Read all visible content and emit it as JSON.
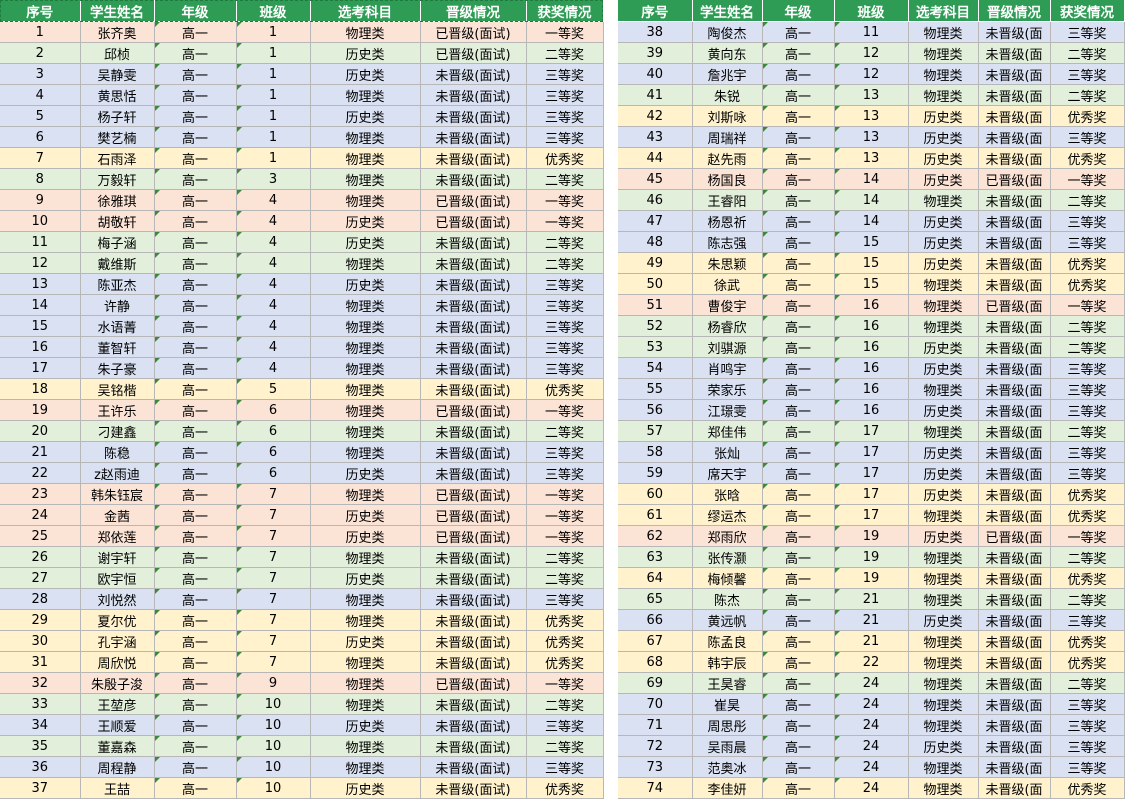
{
  "headers": [
    "序号",
    "学生姓名",
    "年级",
    "班级",
    "选考科目",
    "晋级情况",
    "获奖情况"
  ],
  "colors": {
    "header_bg": "#2e9c55",
    "一等奖": "#fbe3d6",
    "二等奖": "#e2efda",
    "三等奖": "#d9e1f2",
    "优秀奖": "#fff2cc"
  },
  "left_rows": [
    [
      "1",
      "张齐奥",
      "高一",
      "1",
      "物理类",
      "已晋级(面试)",
      "一等奖"
    ],
    [
      "2",
      "邱桢",
      "高一",
      "1",
      "历史类",
      "已晋级(面试)",
      "二等奖"
    ],
    [
      "3",
      "吴静雯",
      "高一",
      "1",
      "历史类",
      "未晋级(面试)",
      "三等奖"
    ],
    [
      "4",
      "黄思恬",
      "高一",
      "1",
      "物理类",
      "未晋级(面试)",
      "三等奖"
    ],
    [
      "5",
      "杨子轩",
      "高一",
      "1",
      "历史类",
      "未晋级(面试)",
      "三等奖"
    ],
    [
      "6",
      "樊艺楠",
      "高一",
      "1",
      "物理类",
      "未晋级(面试)",
      "三等奖"
    ],
    [
      "7",
      "石雨泽",
      "高一",
      "1",
      "物理类",
      "未晋级(面试)",
      "优秀奖"
    ],
    [
      "8",
      "万毅轩",
      "高一",
      "3",
      "物理类",
      "未晋级(面试)",
      "二等奖"
    ],
    [
      "9",
      "徐雅琪",
      "高一",
      "4",
      "物理类",
      "已晋级(面试)",
      "一等奖"
    ],
    [
      "10",
      "胡敬轩",
      "高一",
      "4",
      "历史类",
      "已晋级(面试)",
      "一等奖"
    ],
    [
      "11",
      "梅子涵",
      "高一",
      "4",
      "历史类",
      "未晋级(面试)",
      "二等奖"
    ],
    [
      "12",
      "戴维斯",
      "高一",
      "4",
      "物理类",
      "未晋级(面试)",
      "二等奖"
    ],
    [
      "13",
      "陈亚杰",
      "高一",
      "4",
      "历史类",
      "未晋级(面试)",
      "三等奖"
    ],
    [
      "14",
      "许静",
      "高一",
      "4",
      "物理类",
      "未晋级(面试)",
      "三等奖"
    ],
    [
      "15",
      "水语菁",
      "高一",
      "4",
      "物理类",
      "未晋级(面试)",
      "三等奖"
    ],
    [
      "16",
      "董智轩",
      "高一",
      "4",
      "物理类",
      "未晋级(面试)",
      "三等奖"
    ],
    [
      "17",
      "朱子豪",
      "高一",
      "4",
      "物理类",
      "未晋级(面试)",
      "三等奖"
    ],
    [
      "18",
      "吴铭楷",
      "高一",
      "5",
      "物理类",
      "未晋级(面试)",
      "优秀奖"
    ],
    [
      "19",
      "王许乐",
      "高一",
      "6",
      "物理类",
      "已晋级(面试)",
      "一等奖"
    ],
    [
      "20",
      "刁建鑫",
      "高一",
      "6",
      "物理类",
      "未晋级(面试)",
      "二等奖"
    ],
    [
      "21",
      "陈稳",
      "高一",
      "6",
      "物理类",
      "未晋级(面试)",
      "三等奖"
    ],
    [
      "22",
      "z赵雨迪",
      "高一",
      "6",
      "历史类",
      "未晋级(面试)",
      "三等奖"
    ],
    [
      "23",
      "韩朱钰宸",
      "高一",
      "7",
      "物理类",
      "已晋级(面试)",
      "一等奖"
    ],
    [
      "24",
      "金茜",
      "高一",
      "7",
      "历史类",
      "已晋级(面试)",
      "一等奖"
    ],
    [
      "25",
      "郑依莲",
      "高一",
      "7",
      "历史类",
      "已晋级(面试)",
      "一等奖"
    ],
    [
      "26",
      "谢宇轩",
      "高一",
      "7",
      "物理类",
      "未晋级(面试)",
      "二等奖"
    ],
    [
      "27",
      "欧宇恒",
      "高一",
      "7",
      "历史类",
      "未晋级(面试)",
      "二等奖"
    ],
    [
      "28",
      "刘悦然",
      "高一",
      "7",
      "物理类",
      "未晋级(面试)",
      "三等奖"
    ],
    [
      "29",
      "夏尔优",
      "高一",
      "7",
      "物理类",
      "未晋级(面试)",
      "优秀奖"
    ],
    [
      "30",
      "孔宇涵",
      "高一",
      "7",
      "历史类",
      "未晋级(面试)",
      "优秀奖"
    ],
    [
      "31",
      "周欣悦",
      "高一",
      "7",
      "物理类",
      "未晋级(面试)",
      "优秀奖"
    ],
    [
      "32",
      "朱殷子浚",
      "高一",
      "9",
      "物理类",
      "已晋级(面试)",
      "一等奖"
    ],
    [
      "33",
      "王堃彦",
      "高一",
      "10",
      "物理类",
      "未晋级(面试)",
      "二等奖"
    ],
    [
      "34",
      "王顺爱",
      "高一",
      "10",
      "历史类",
      "未晋级(面试)",
      "三等奖"
    ],
    [
      "35",
      "董嘉森",
      "高一",
      "10",
      "物理类",
      "未晋级(面试)",
      "二等奖"
    ],
    [
      "36",
      "周程静",
      "高一",
      "10",
      "物理类",
      "未晋级(面试)",
      "三等奖"
    ],
    [
      "37",
      "王喆",
      "高一",
      "10",
      "历史类",
      "未晋级(面试)",
      "优秀奖"
    ]
  ],
  "right_rows": [
    [
      "38",
      "陶俊杰",
      "高一",
      "11",
      "物理类",
      "未晋级(面",
      "三等奖"
    ],
    [
      "39",
      "黄向东",
      "高一",
      "12",
      "物理类",
      "未晋级(面",
      "二等奖"
    ],
    [
      "40",
      "詹兆宇",
      "高一",
      "12",
      "物理类",
      "未晋级(面",
      "三等奖"
    ],
    [
      "41",
      "朱锐",
      "高一",
      "13",
      "物理类",
      "未晋级(面",
      "二等奖"
    ],
    [
      "42",
      "刘斯咏",
      "高一",
      "13",
      "历史类",
      "未晋级(面",
      "优秀奖"
    ],
    [
      "43",
      "周瑞祥",
      "高一",
      "13",
      "历史类",
      "未晋级(面",
      "三等奖"
    ],
    [
      "44",
      "赵先雨",
      "高一",
      "13",
      "历史类",
      "未晋级(面",
      "优秀奖"
    ],
    [
      "45",
      "杨国良",
      "高一",
      "14",
      "历史类",
      "已晋级(面",
      "一等奖"
    ],
    [
      "46",
      "王睿阳",
      "高一",
      "14",
      "物理类",
      "未晋级(面",
      "二等奖"
    ],
    [
      "47",
      "杨恩祈",
      "高一",
      "14",
      "历史类",
      "未晋级(面",
      "三等奖"
    ],
    [
      "48",
      "陈志强",
      "高一",
      "15",
      "历史类",
      "未晋级(面",
      "三等奖"
    ],
    [
      "49",
      "朱思颖",
      "高一",
      "15",
      "历史类",
      "未晋级(面",
      "优秀奖"
    ],
    [
      "50",
      "徐武",
      "高一",
      "15",
      "物理类",
      "未晋级(面",
      "优秀奖"
    ],
    [
      "51",
      "曹俊宇",
      "高一",
      "16",
      "物理类",
      "已晋级(面",
      "一等奖"
    ],
    [
      "52",
      "杨睿欣",
      "高一",
      "16",
      "物理类",
      "未晋级(面",
      "二等奖"
    ],
    [
      "53",
      "刘骐源",
      "高一",
      "16",
      "历史类",
      "未晋级(面",
      "二等奖"
    ],
    [
      "54",
      "肖鸣宇",
      "高一",
      "16",
      "历史类",
      "未晋级(面",
      "三等奖"
    ],
    [
      "55",
      "荣家乐",
      "高一",
      "16",
      "物理类",
      "未晋级(面",
      "三等奖"
    ],
    [
      "56",
      "江璟雯",
      "高一",
      "16",
      "历史类",
      "未晋级(面",
      "三等奖"
    ],
    [
      "57",
      "郑佳伟",
      "高一",
      "17",
      "物理类",
      "未晋级(面",
      "二等奖"
    ],
    [
      "58",
      "张灿",
      "高一",
      "17",
      "历史类",
      "未晋级(面",
      "三等奖"
    ],
    [
      "59",
      "席天宇",
      "高一",
      "17",
      "历史类",
      "未晋级(面",
      "三等奖"
    ],
    [
      "60",
      "张晗",
      "高一",
      "17",
      "历史类",
      "未晋级(面",
      "优秀奖"
    ],
    [
      "61",
      "缪运杰",
      "高一",
      "17",
      "物理类",
      "未晋级(面",
      "优秀奖"
    ],
    [
      "62",
      "郑雨欣",
      "高一",
      "19",
      "历史类",
      "已晋级(面",
      "一等奖"
    ],
    [
      "63",
      "张传灏",
      "高一",
      "19",
      "物理类",
      "未晋级(面",
      "二等奖"
    ],
    [
      "64",
      "梅倾馨",
      "高一",
      "19",
      "物理类",
      "未晋级(面",
      "优秀奖"
    ],
    [
      "65",
      "陈杰",
      "高一",
      "21",
      "物理类",
      "未晋级(面",
      "二等奖"
    ],
    [
      "66",
      "黄远帆",
      "高一",
      "21",
      "历史类",
      "未晋级(面",
      "三等奖"
    ],
    [
      "67",
      "陈孟良",
      "高一",
      "21",
      "物理类",
      "未晋级(面",
      "优秀奖"
    ],
    [
      "68",
      "韩宇辰",
      "高一",
      "22",
      "物理类",
      "未晋级(面",
      "优秀奖"
    ],
    [
      "69",
      "王昊睿",
      "高一",
      "24",
      "物理类",
      "未晋级(面",
      "二等奖"
    ],
    [
      "70",
      "崔昊",
      "高一",
      "24",
      "物理类",
      "未晋级(面",
      "三等奖"
    ],
    [
      "71",
      "周思彤",
      "高一",
      "24",
      "物理类",
      "未晋级(面",
      "三等奖"
    ],
    [
      "72",
      "吴雨晨",
      "高一",
      "24",
      "历史类",
      "未晋级(面",
      "三等奖"
    ],
    [
      "73",
      "范奥冰",
      "高一",
      "24",
      "物理类",
      "未晋级(面",
      "三等奖"
    ],
    [
      "74",
      "李佳妍",
      "高一",
      "24",
      "物理类",
      "未晋级(面",
      "优秀奖"
    ]
  ]
}
